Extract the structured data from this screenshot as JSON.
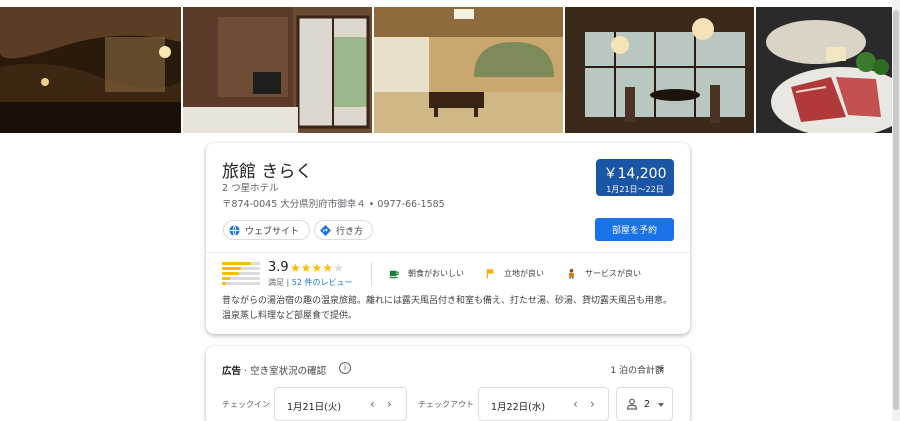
{
  "photos": [
    {
      "name": "onsen-interior-photo"
    },
    {
      "name": "guest-room-window-photo"
    },
    {
      "name": "tatami-room-photo"
    },
    {
      "name": "dining-room-photo"
    },
    {
      "name": "wagyu-dish-photo"
    }
  ],
  "hotel": {
    "name": "旅館 きらく",
    "class": "2 つ星ホテル",
    "address": "〒874-0045 大分県別府市御幸４ • 0977-66-1585",
    "description": "昔ながらの湯治宿の趣の温泉旅館。離れには露天風呂付き和室も備え、打たせ湯、砂湯、貸切露天風呂も用意。温泉蒸し料理など部屋食で提供。"
  },
  "price": {
    "amount": "￥14,200",
    "dates": "1月21日～22日"
  },
  "actions": {
    "website": "ウェブサイト",
    "directions": "行き方",
    "reserve": "部屋を予約"
  },
  "rating": {
    "score": "3.9",
    "stars": 3.9,
    "summary": "満足",
    "reviews": "52 件のレビュー",
    "distribution": [
      0.75,
      0.5,
      0.45,
      0.2,
      0.1
    ]
  },
  "features": [
    {
      "icon": "coffee-cup-icon",
      "label": "朝食がおいしい"
    },
    {
      "icon": "flag-icon",
      "label": "立地が良い"
    },
    {
      "icon": "bellhop-icon",
      "label": "サービスが良い"
    }
  ],
  "availability": {
    "ad_label": "広告",
    "title": " · 空き室状況の確認",
    "total_label": "1 泊の合計額",
    "checkin_label": "チェックイン",
    "checkin_value": "1月21日(火)",
    "checkout_label": "チェックアウト",
    "checkout_value": "1月22日(水)",
    "guests": "2"
  },
  "colors": {
    "price_badge": "#1a56a6",
    "reserve_button": "#1a73e8",
    "star": "#fbbc04",
    "link": "#1a73e8"
  }
}
